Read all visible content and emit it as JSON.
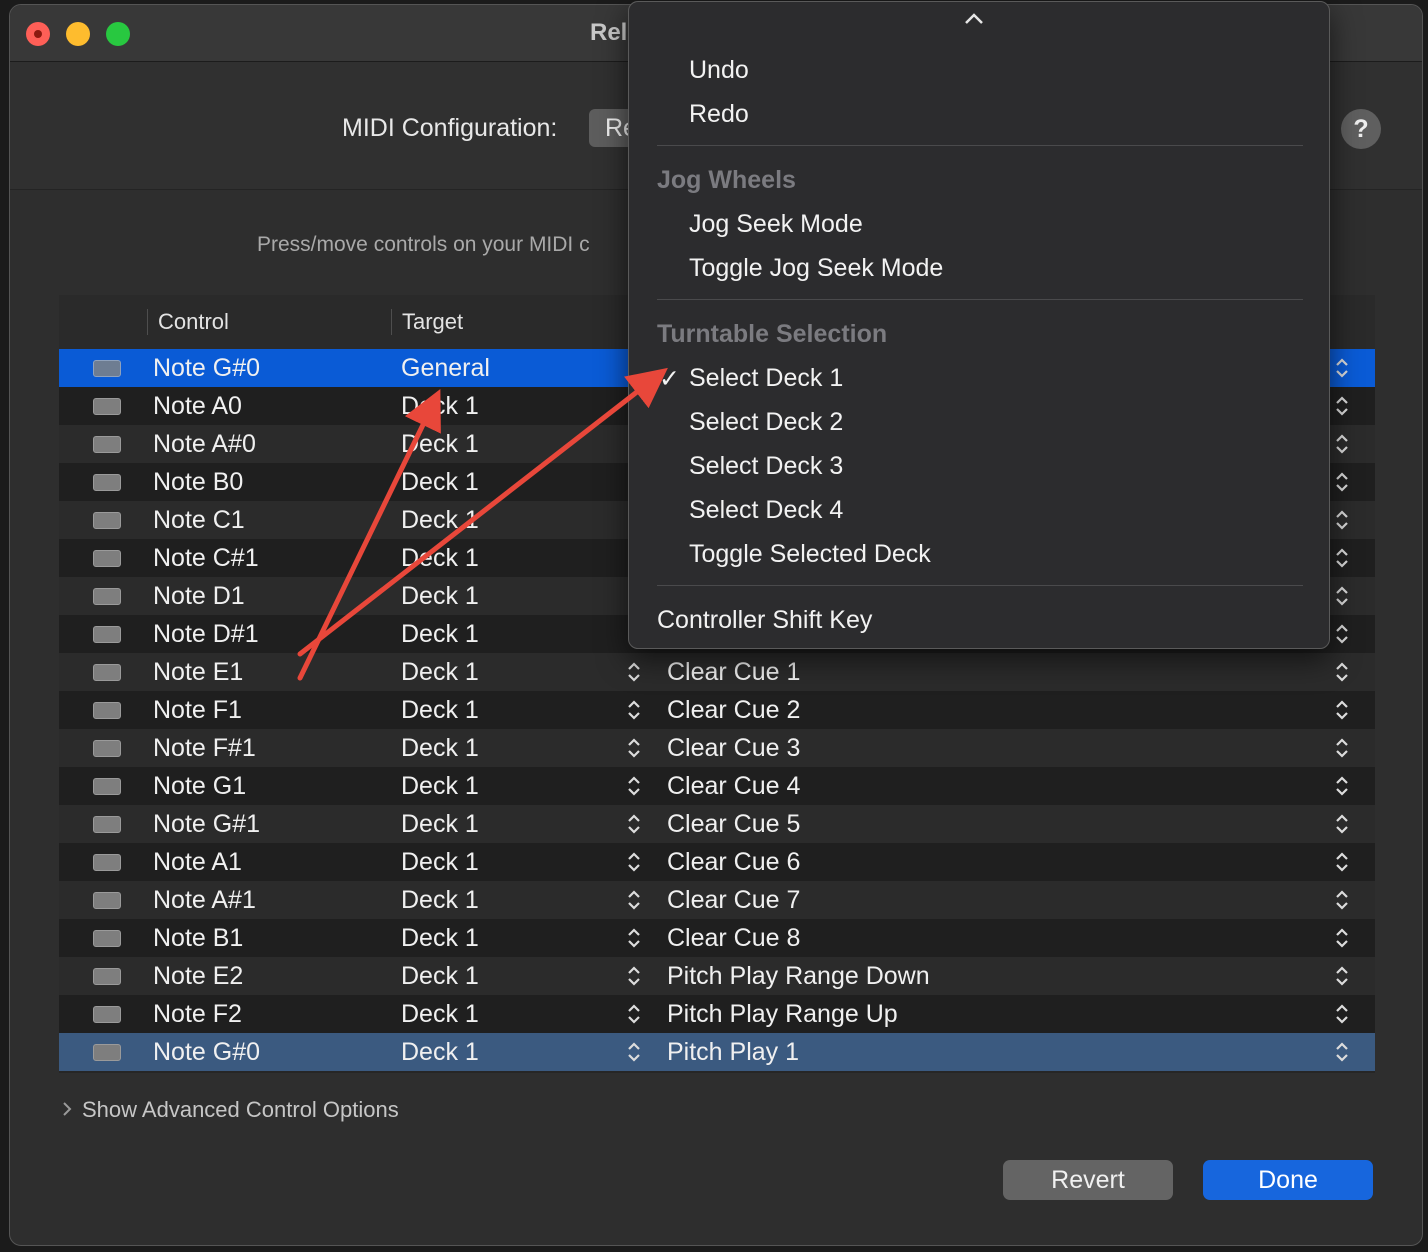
{
  "window": {
    "title": "Rel",
    "controls": [
      "close",
      "minimize",
      "zoom"
    ]
  },
  "header": {
    "midi_config_label": "MIDI Configuration:",
    "midi_config_value": "Re",
    "help_label": "?"
  },
  "instructions": "Press/move controls on your MIDI c",
  "table": {
    "columns": [
      "Control",
      "Target"
    ],
    "rows": [
      {
        "control": "Note G#0",
        "target": "General",
        "action": "",
        "state": "selected"
      },
      {
        "control": "Note A0",
        "target": "Deck 1",
        "action": "",
        "state": "odd"
      },
      {
        "control": "Note A#0",
        "target": "Deck 1",
        "action": "",
        "state": "even"
      },
      {
        "control": "Note B0",
        "target": "Deck 1",
        "action": "",
        "state": "odd"
      },
      {
        "control": "Note C1",
        "target": "Deck 1",
        "action": "",
        "state": "even"
      },
      {
        "control": "Note C#1",
        "target": "Deck 1",
        "action": "",
        "state": "odd"
      },
      {
        "control": "Note D1",
        "target": "Deck 1",
        "action": "",
        "state": "even"
      },
      {
        "control": "Note D#1",
        "target": "Deck 1",
        "action": "",
        "state": "odd"
      },
      {
        "control": "Note E1",
        "target": "Deck 1",
        "action": "Clear Cue 1",
        "state": "even"
      },
      {
        "control": "Note F1",
        "target": "Deck 1",
        "action": "Clear Cue 2",
        "state": "odd"
      },
      {
        "control": "Note F#1",
        "target": "Deck 1",
        "action": "Clear Cue 3",
        "state": "even"
      },
      {
        "control": "Note G1",
        "target": "Deck 1",
        "action": "Clear Cue 4",
        "state": "odd"
      },
      {
        "control": "Note G#1",
        "target": "Deck 1",
        "action": "Clear Cue 5",
        "state": "even"
      },
      {
        "control": "Note A1",
        "target": "Deck 1",
        "action": "Clear Cue 6",
        "state": "odd"
      },
      {
        "control": "Note A#1",
        "target": "Deck 1",
        "action": "Clear Cue 7",
        "state": "even"
      },
      {
        "control": "Note B1",
        "target": "Deck 1",
        "action": "Clear Cue 8",
        "state": "odd"
      },
      {
        "control": "Note E2",
        "target": "Deck 1",
        "action": "Pitch Play Range Down",
        "state": "even"
      },
      {
        "control": "Note F2",
        "target": "Deck 1",
        "action": "Pitch Play Range Up",
        "state": "odd"
      },
      {
        "control": "Note G#0",
        "target": "Deck 1",
        "action": "Pitch Play 1",
        "state": "selected-inactive"
      }
    ]
  },
  "advanced_options": "Show Advanced Control Options",
  "buttons": {
    "revert": "Revert",
    "done": "Done"
  },
  "menu": {
    "undo": "Undo",
    "redo": "Redo",
    "section_jog": "Jog Wheels",
    "jog_seek_mode": "Jog Seek Mode",
    "toggle_jog_seek_mode": "Toggle Jog Seek Mode",
    "section_turntable": "Turntable Selection",
    "checkmark": "✓",
    "select_deck_1": "Select Deck 1",
    "select_deck_2": "Select Deck 2",
    "select_deck_3": "Select Deck 3",
    "select_deck_4": "Select Deck 4",
    "toggle_selected_deck": "Toggle Selected Deck",
    "controller_shift_key": "Controller Shift Key",
    "checked_item": "Select Deck 1"
  },
  "colors": {
    "selection_blue": "#0a5bd6",
    "inactive_selection": "#3b5a80",
    "done_blue": "#1766dd",
    "annotation_arrow": "#e8473a"
  },
  "icons": {
    "stepper": "up-down-chevron-icon",
    "menu_scroll": "chevron-up-icon",
    "disclosure": "chevron-right-icon"
  }
}
